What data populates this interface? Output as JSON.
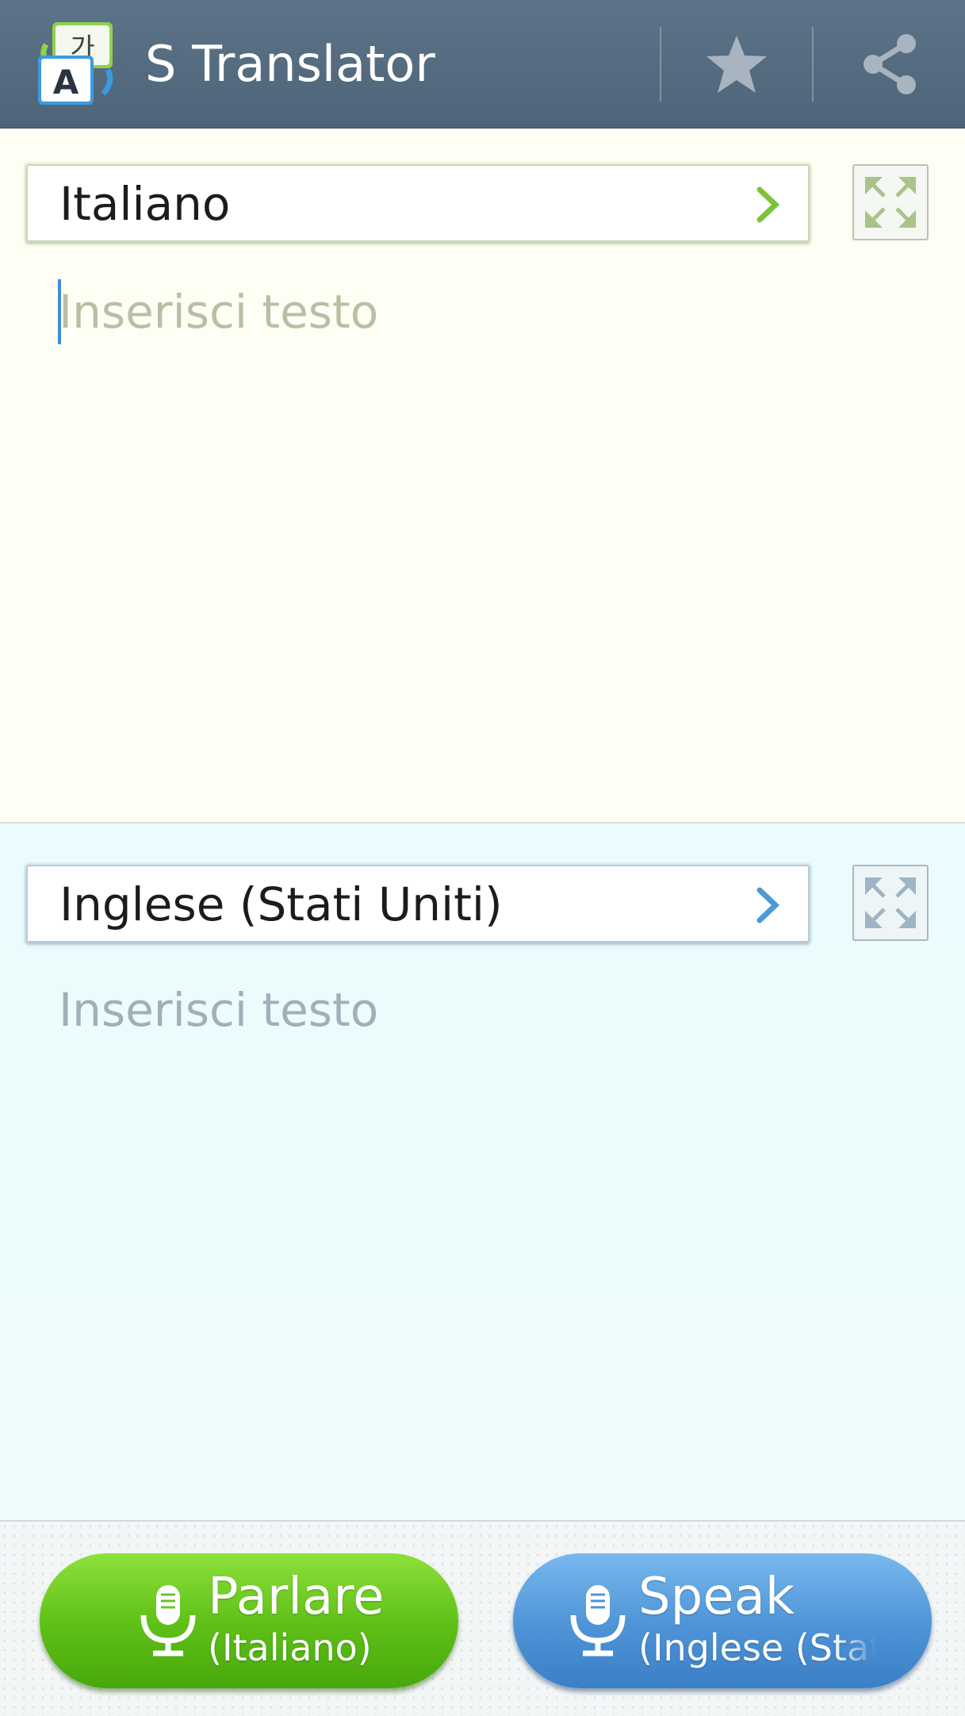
{
  "app": {
    "title": "S Translator",
    "logo_front_char": "A",
    "logo_back_char": "가"
  },
  "actions": {
    "favorites_icon": "star-icon",
    "share_icon": "share-icon"
  },
  "source": {
    "language": "Italiano",
    "placeholder": "Inserisci testo",
    "accent": "#7ec23a"
  },
  "target": {
    "language": "Inglese (Stati Uniti)",
    "placeholder": "Inserisci testo",
    "accent": "#4a9ad8"
  },
  "voice": {
    "source_button": {
      "label": "Parlare",
      "sublabel": "(Italiano)"
    },
    "target_button": {
      "label": "Speak",
      "sublabel": "(Inglese (Stati Uniti))"
    }
  }
}
